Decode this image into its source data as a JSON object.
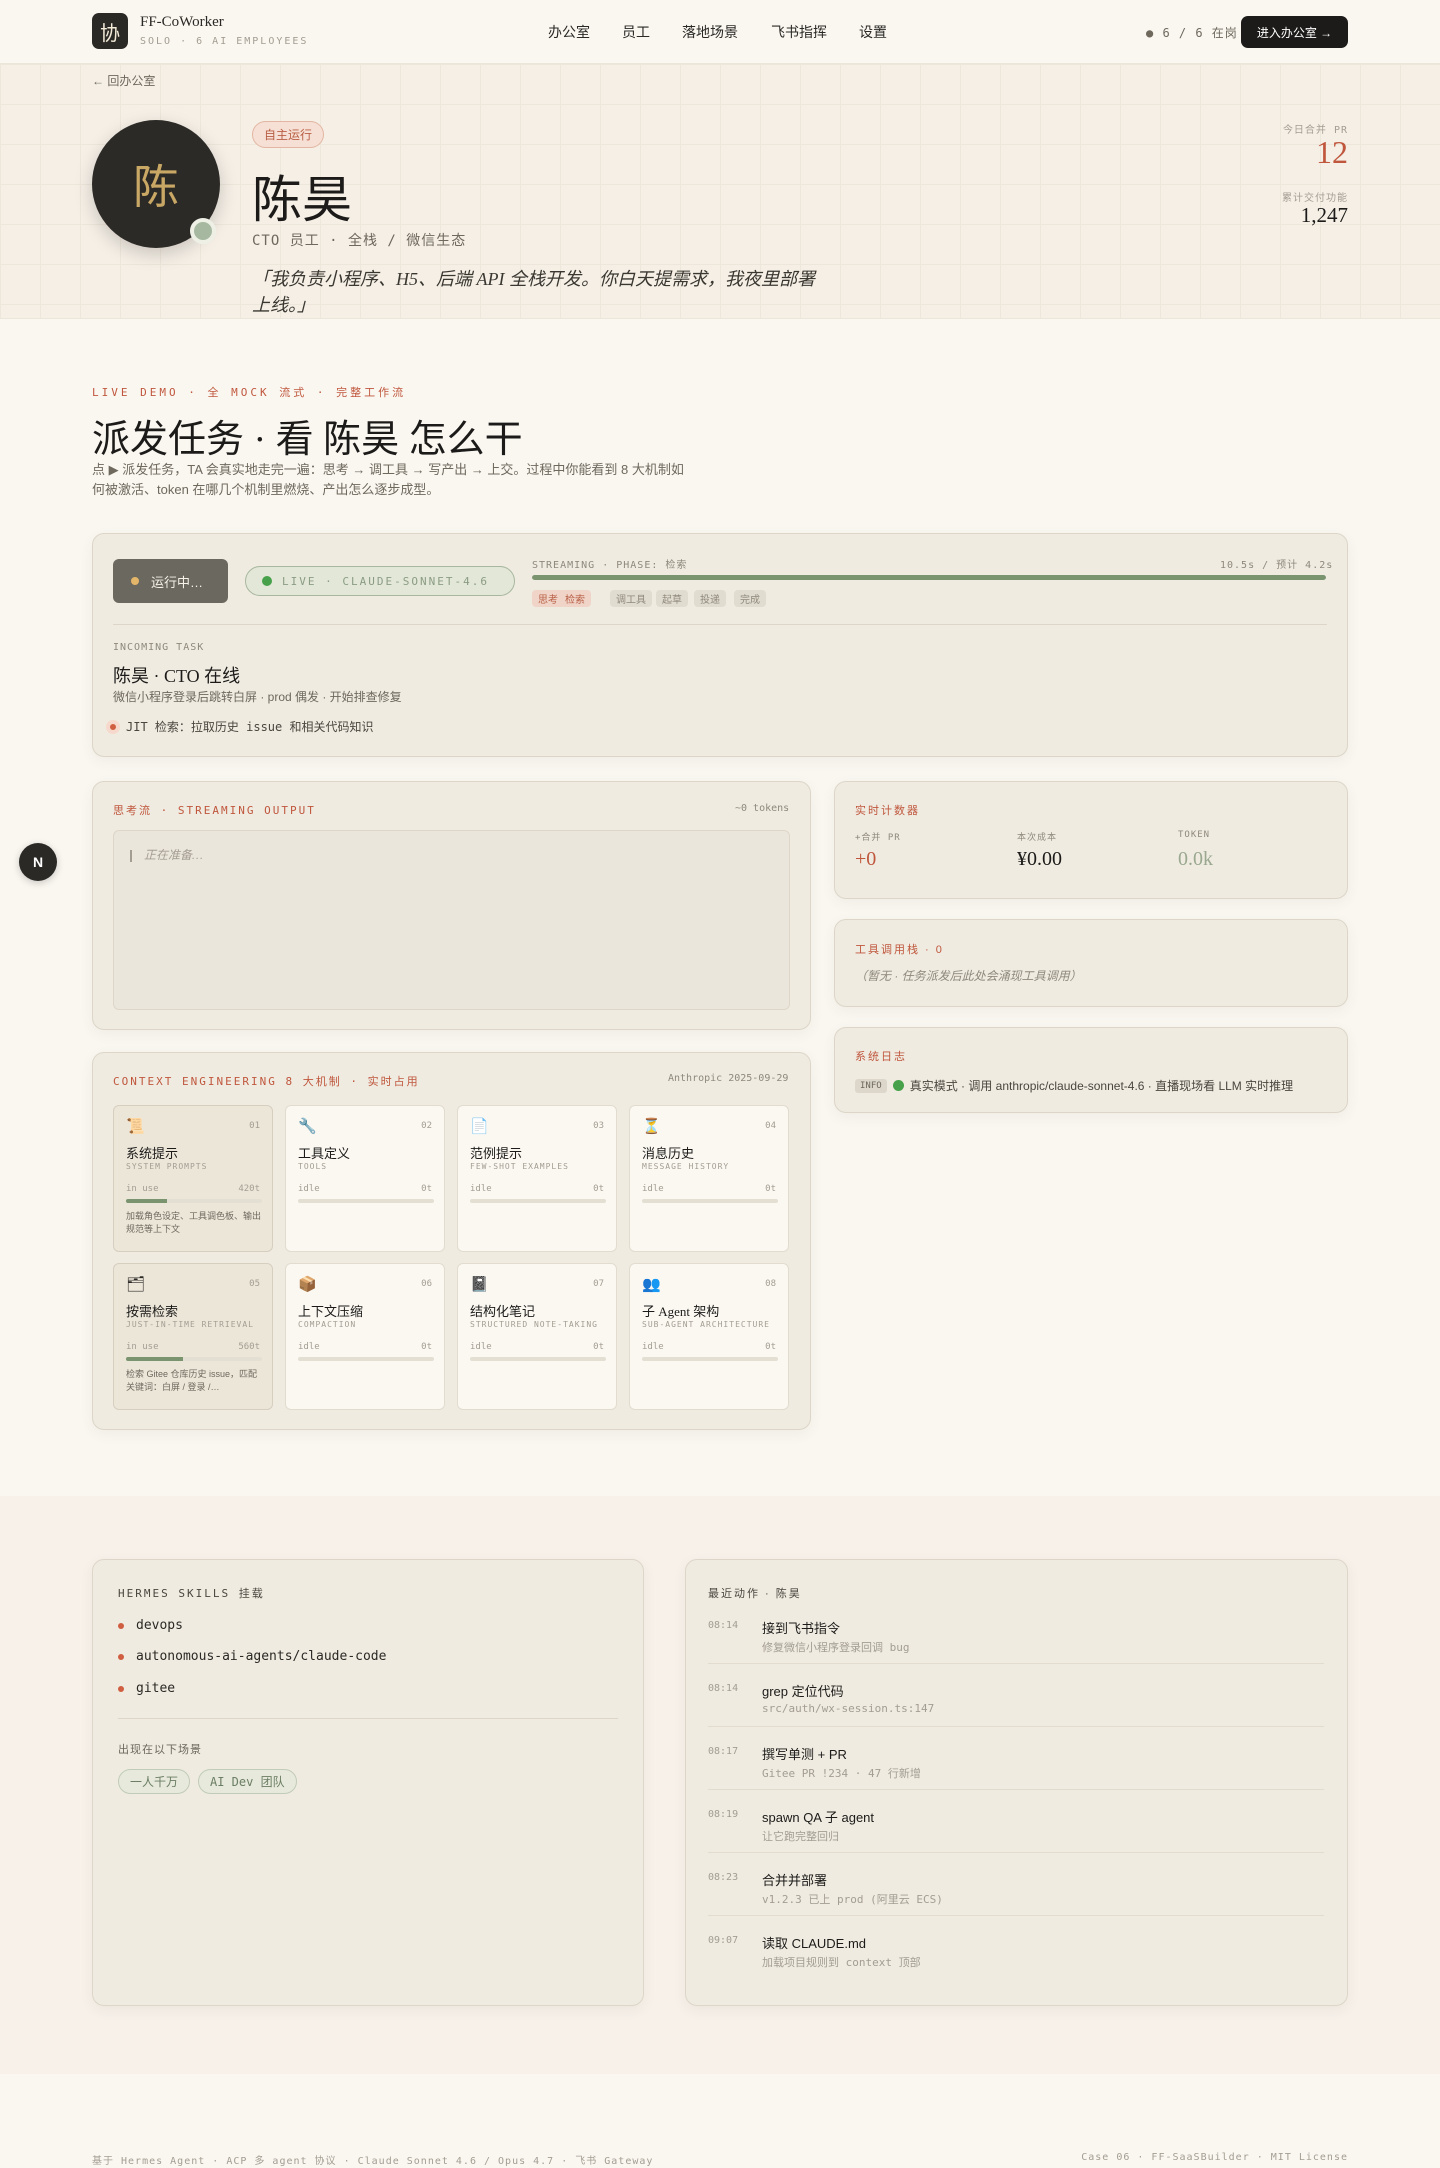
{
  "header": {
    "logo_char": "协",
    "brand": "FF-CoWorker",
    "brand_sub": "SOLO · 6 AI EMPLOYEES",
    "nav": [
      "办公室",
      "员工",
      "落地场景",
      "飞书指挥",
      "设置"
    ],
    "online": "● 6 / 6 在岗",
    "enter_label": "进入办公室 →"
  },
  "hero": {
    "back": "← 回办公室",
    "avatar_char": "陈",
    "status_badge": "自主运行",
    "name": "陈昊",
    "role": "CTO 员工 · 全栈 / 微信生态",
    "quote": "「我负责小程序、H5、后端 API 全栈开发。你白天提需求，我夜里部署上线。」",
    "stats": [
      {
        "label": "今日合并 PR",
        "value": "12"
      },
      {
        "label": "累计交付功能",
        "value": "1,247"
      }
    ]
  },
  "demo": {
    "eyebrow": "LIVE DEMO · 全 MOCK 流式 · 完整工作流",
    "title": "派发任务 · 看 陈昊 怎么干",
    "desc": "点 ▶ 派发任务，TA 会真实地走完一遍：思考 → 调工具 → 写产出 → 上交。过程中你能看到 8 大机制如何被激活、token 在哪几个机制里燃烧、产出怎么逐步成型。",
    "run_label": "运行中…",
    "live_pill": "LIVE · CLAUDE-SONNET-4.6",
    "phase_label": "STREAMING · PHASE: 检索",
    "phase_time": "10.5s / 预计 4.2s",
    "progress": 1.0,
    "phases": [
      {
        "label": "思考",
        "active": true
      },
      {
        "label": "检索",
        "active": true
      },
      {
        "label": "调工具",
        "active": false
      },
      {
        "label": "起草",
        "active": false
      },
      {
        "label": "投递",
        "active": false
      },
      {
        "label": "完成",
        "active": false
      }
    ],
    "task_label": "INCOMING TASK",
    "task_title": "陈昊 · CTO 在线",
    "task_desc": "微信小程序登录后跳转白屏 · prod 偶发 · 开始排查修复",
    "task_step": "JIT 检索：拉取历史 issue 和相关代码知识"
  },
  "stream": {
    "label": "思考流 · STREAMING OUTPUT",
    "tokens": "~0 tokens",
    "placeholder": "正在准备…"
  },
  "counters": {
    "label": "实时计数器",
    "items": [
      {
        "label": "+合并 PR",
        "value": "+0"
      },
      {
        "label": "本次成本",
        "value": "¥0.00"
      },
      {
        "label": "TOKEN",
        "value": "0.0k"
      }
    ]
  },
  "tools": {
    "label": "工具调用栈 · 0",
    "empty": "（暂无 · 任务派发后此处会涌现工具调用）"
  },
  "syslog": {
    "label": "系统日志",
    "tag": "INFO",
    "line": "真实模式 · 调用 anthropic/claude-sonnet-4.6 · 直播现场看 LLM 实时推理"
  },
  "context": {
    "label": "CONTEXT ENGINEERING 8 大机制 · 实时占用",
    "date": "Anthropic 2025-09-29",
    "mechanisms": [
      {
        "no": "01",
        "icon": "📜",
        "icon_name": "scroll-icon",
        "name": "系统提示",
        "sub": "SYSTEM PROMPTS",
        "state": "in use",
        "tokens": "420t",
        "usage": 0.3,
        "desc": "加载角色设定、工具调色板、输出规范等上下文",
        "active": true
      },
      {
        "no": "02",
        "icon": "🔧",
        "icon_name": "wrench-icon",
        "name": "工具定义",
        "sub": "TOOLS",
        "state": "idle",
        "tokens": "0t",
        "usage": 0,
        "desc": "",
        "active": false
      },
      {
        "no": "03",
        "icon": "📄",
        "icon_name": "document-icon",
        "name": "范例提示",
        "sub": "FEW-SHOT EXAMPLES",
        "state": "idle",
        "tokens": "0t",
        "usage": 0,
        "desc": "",
        "active": false
      },
      {
        "no": "04",
        "icon": "⏳",
        "icon_name": "hourglass-icon",
        "name": "消息历史",
        "sub": "MESSAGE HISTORY",
        "state": "idle",
        "tokens": "0t",
        "usage": 0,
        "desc": "",
        "active": false
      },
      {
        "no": "05",
        "icon": "🗂",
        "icon_name": "folder-icon",
        "name": "按需检索",
        "sub": "JUST-IN-TIME RETRIEVAL",
        "state": "in use",
        "tokens": "560t",
        "usage": 0.42,
        "desc": "检索 Gitee 仓库历史 issue，匹配关键词：白屏 / 登录 /…",
        "active": true
      },
      {
        "no": "06",
        "icon": "📦",
        "icon_name": "package-icon",
        "name": "上下文压缩",
        "sub": "COMPACTION",
        "state": "idle",
        "tokens": "0t",
        "usage": 0,
        "desc": "",
        "active": false
      },
      {
        "no": "07",
        "icon": "📓",
        "icon_name": "notebook-icon",
        "name": "结构化笔记",
        "sub": "STRUCTURED NOTE-TAKING",
        "state": "idle",
        "tokens": "0t",
        "usage": 0,
        "desc": "",
        "active": false
      },
      {
        "no": "08",
        "icon": "👥",
        "icon_name": "people-icon",
        "name": "子 Agent 架构",
        "sub": "SUB-AGENT ARCHITECTURE",
        "state": "idle",
        "tokens": "0t",
        "usage": 0,
        "desc": "",
        "active": false
      }
    ]
  },
  "skills": {
    "label": "HERMES SKILLS 挂载",
    "items": [
      "devops",
      "autonomous-ai-agents/claude-code",
      "gitee"
    ],
    "scenes_label": "出现在以下场景",
    "scenes": [
      "一人千万",
      "AI Dev 团队"
    ]
  },
  "activity": {
    "label": "最近动作 · 陈昊",
    "items": [
      {
        "time": "08:14",
        "title": "接到飞书指令",
        "sub": "修复微信小程序登录回调 bug"
      },
      {
        "time": "08:14",
        "title": "grep 定位代码",
        "sub": "src/auth/wx-session.ts:147"
      },
      {
        "time": "08:17",
        "title": "撰写单测 + PR",
        "sub": "Gitee PR !234 · 47 行新增"
      },
      {
        "time": "08:19",
        "title": "spawn QA 子 agent",
        "sub": "让它跑完整回归"
      },
      {
        "time": "08:23",
        "title": "合并并部署",
        "sub": "v1.2.3 已上 prod (阿里云 ECS)"
      },
      {
        "time": "09:07",
        "title": "读取 CLAUDE.md",
        "sub": "加载项目规则到 context 顶部"
      }
    ]
  },
  "footer": {
    "left": "基于 Hermes Agent · ACP 多 agent 协议 · Claude Sonnet 4.6 / Opus 4.7 · 飞书 Gateway",
    "right": "Case 06 · FF-SaaSBuilder · MIT License"
  },
  "floating_button": "N",
  "colors": {
    "accent": "#c0573d",
    "progress": "#7a9470",
    "live": "#47a14a",
    "dark": "#1c1b19"
  }
}
